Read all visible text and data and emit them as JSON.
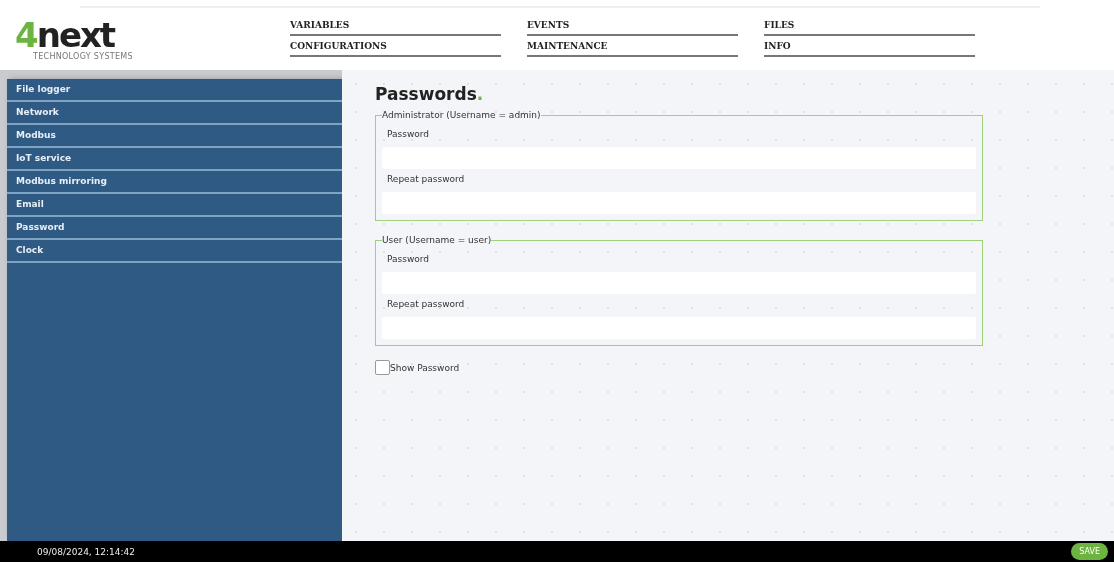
{
  "logo": {
    "mark": "4",
    "name": "next",
    "tagline": "TECHNOLOGY SYSTEMS"
  },
  "nav": [
    [
      "VARIABLES",
      "CONFIGURATIONS"
    ],
    [
      "EVENTS",
      "MAINTENANCE"
    ],
    [
      "FILES",
      "INFO"
    ]
  ],
  "sidebar": {
    "items": [
      "File logger",
      "Network",
      "Modbus",
      "IoT service",
      "Modbus mirroring",
      "Email",
      "Password",
      "Clock"
    ]
  },
  "page": {
    "title": "Passwords",
    "title_dot": ".",
    "groups": [
      {
        "legend": "Administrator (Username = admin)",
        "fields": [
          {
            "label": "Password"
          },
          {
            "label": "Repeat password"
          }
        ]
      },
      {
        "legend": "User (Username = user)",
        "fields": [
          {
            "label": "Password"
          },
          {
            "label": "Repeat password"
          }
        ]
      }
    ],
    "show_password": {
      "label": "Show Password",
      "checked": false
    }
  },
  "status_bar": {
    "datetime": "09/08/2024, 12:14:42",
    "save": "SAVE"
  }
}
